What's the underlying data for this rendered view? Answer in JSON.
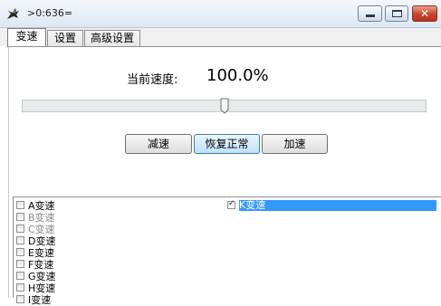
{
  "window": {
    "title": ">0:636=",
    "controls": {
      "minimize_icon": "minimize-icon",
      "maximize_icon": "maximize-icon",
      "close_icon": "close-icon"
    },
    "close_glyph": "✕"
  },
  "tabs": [
    {
      "label": "变速",
      "active": true
    },
    {
      "label": "设置",
      "active": false
    },
    {
      "label": "高级设置",
      "active": false
    }
  ],
  "speed": {
    "label": "当前速度:",
    "value": "100.0%",
    "slider_fraction": 0.5
  },
  "buttons": {
    "decrease": "减速",
    "reset": "恢复正常",
    "increase": "加速"
  },
  "list": {
    "left_items": [
      {
        "label": "A变速",
        "checked": false,
        "dim": false
      },
      {
        "label": "B变速",
        "checked": false,
        "dim": true
      },
      {
        "label": "C变速",
        "checked": false,
        "dim": true
      },
      {
        "label": "D变速",
        "checked": false,
        "dim": false
      },
      {
        "label": "E变速",
        "checked": false,
        "dim": false
      },
      {
        "label": "F变速",
        "checked": false,
        "dim": false
      },
      {
        "label": "G变速",
        "checked": false,
        "dim": false
      },
      {
        "label": "H变速",
        "checked": false,
        "dim": false
      },
      {
        "label": "I变速",
        "checked": false,
        "dim": false
      }
    ],
    "right_item": {
      "label": "K变速",
      "checked": true,
      "selected": true
    }
  },
  "colors": {
    "selection": "#3399ff",
    "close_button": "#c9442a"
  }
}
